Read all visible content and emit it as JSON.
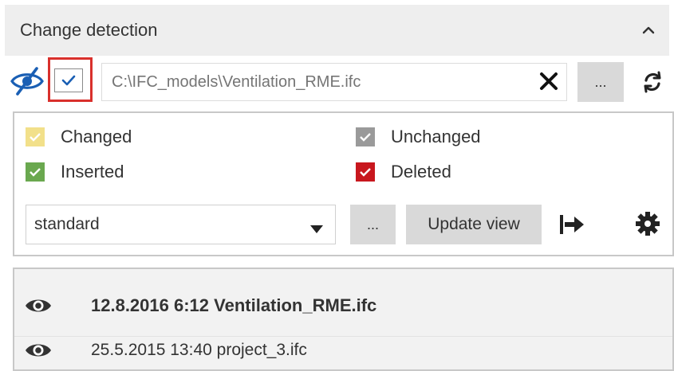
{
  "header": {
    "title": "Change detection"
  },
  "compare": {
    "enabled": true,
    "path_placeholder": "C:\\IFC_models\\Ventilation_RME.ifc",
    "browse_label": "..."
  },
  "legend": {
    "items": [
      {
        "label": "Changed",
        "color": "#f2e08a"
      },
      {
        "label": "Unchanged",
        "color": "#9a9a9a"
      },
      {
        "label": "Inserted",
        "color": "#6aa84f"
      },
      {
        "label": "Deleted",
        "color": "#c8171e"
      }
    ]
  },
  "controls": {
    "view_mode": "standard",
    "more_label": "...",
    "update_label": "Update view"
  },
  "history": {
    "items": [
      {
        "label": "12.8.2016 6:12 Ventilation_RME.ifc",
        "current": true
      },
      {
        "label": "25.5.2015 13:40 project_3.ifc",
        "current": false
      }
    ]
  },
  "icons": {
    "visibility_toggle": "eye-slash-icon",
    "clear": "close-icon",
    "refresh": "refresh-icon",
    "export": "export-arrow-icon",
    "settings": "gear-icon",
    "dropdown": "caret-down-icon",
    "collapse": "chevron-up-icon",
    "row_visibility": "eye-icon"
  },
  "colors": {
    "accent": "#1a5fb4",
    "highlight": "#d9302c"
  }
}
